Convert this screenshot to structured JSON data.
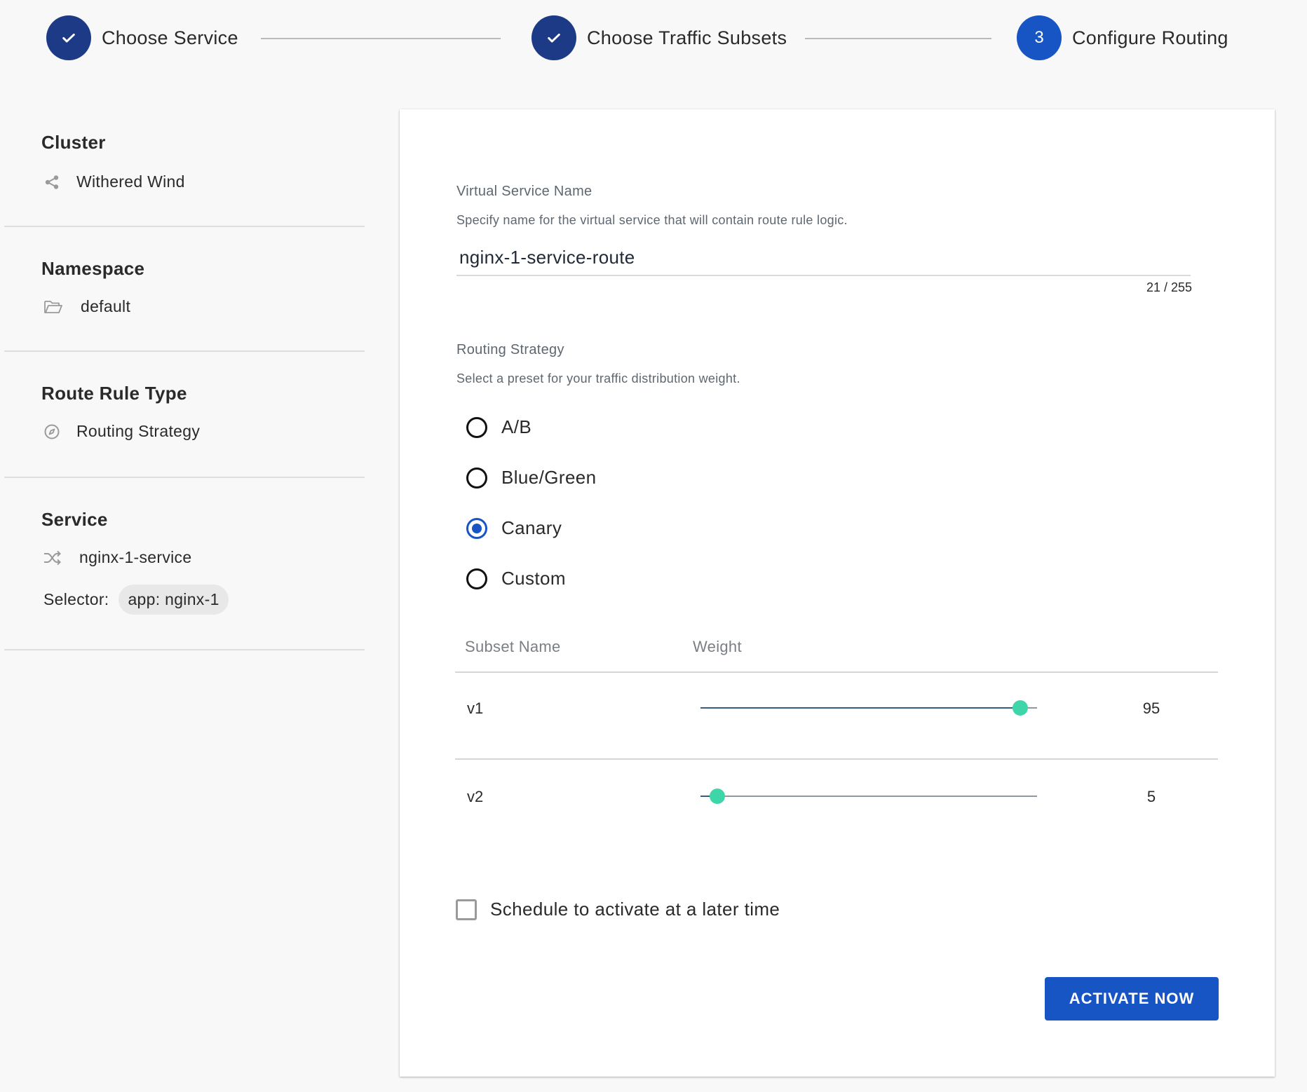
{
  "stepper": {
    "steps": [
      {
        "label": "Choose Service",
        "number": "1",
        "state": "done"
      },
      {
        "label": "Choose Traffic Subsets",
        "number": "2",
        "state": "done"
      },
      {
        "label": "Configure Routing",
        "number": "3",
        "state": "active"
      }
    ]
  },
  "sidebar": {
    "cluster": {
      "title": "Cluster",
      "value": "Withered Wind",
      "icon": "share-icon"
    },
    "namespace": {
      "title": "Namespace",
      "value": "default",
      "icon": "folder-open-icon"
    },
    "route_rule_type": {
      "title": "Route Rule Type",
      "value": "Routing Strategy",
      "icon": "compass-icon"
    },
    "service": {
      "title": "Service",
      "value": "nginx-1-service",
      "icon": "shuffle-icon",
      "selector_label": "Selector:",
      "selector_chip": "app: nginx-1"
    }
  },
  "form": {
    "virtual_service": {
      "label": "Virtual Service Name",
      "help": "Specify name for the virtual service that will contain route rule logic.",
      "value": "nginx-1-service-route",
      "counter": "21 / 255"
    },
    "routing_strategy": {
      "label": "Routing Strategy",
      "help": "Select a preset for your traffic distribution weight.",
      "options": [
        {
          "label": "A/B",
          "checked": false
        },
        {
          "label": "Blue/Green",
          "checked": false
        },
        {
          "label": "Canary",
          "checked": true
        },
        {
          "label": "Custom",
          "checked": false
        }
      ]
    },
    "subsets": {
      "columns": [
        "Subset Name",
        "Weight"
      ],
      "rows": [
        {
          "name": "v1",
          "weight": 95,
          "weight_label": "95"
        },
        {
          "name": "v2",
          "weight": 5,
          "weight_label": "5"
        }
      ]
    },
    "schedule": {
      "label": "Schedule to activate at a later time",
      "checked": false
    },
    "activate_label": "ACTIVATE NOW"
  },
  "colors": {
    "primary": "#1754c4",
    "step_done": "#1c3a86",
    "slider_thumb": "#3ed6a8"
  }
}
